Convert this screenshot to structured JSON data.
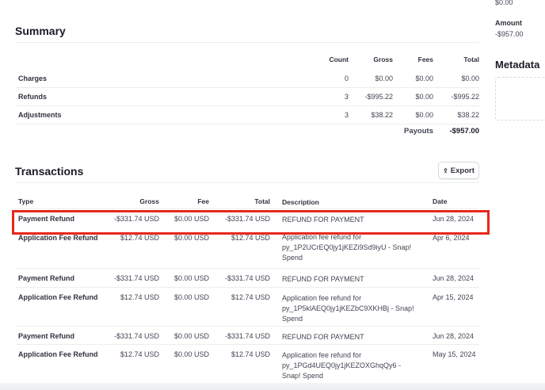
{
  "side": {
    "top_value": "$0.00",
    "amount_label": "Amount",
    "amount_value": "-$957.00",
    "metadata_title": "Metadata"
  },
  "summary": {
    "title": "Summary",
    "columns": [
      "Count",
      "Gross",
      "Fees",
      "Total"
    ],
    "rows": [
      {
        "label": "Charges",
        "count": "0",
        "gross": "$0.00",
        "fees": "$0.00",
        "total": "$0.00"
      },
      {
        "label": "Refunds",
        "count": "3",
        "gross": "-$995.22",
        "fees": "$0.00",
        "total": "-$995.22"
      },
      {
        "label": "Adjustments",
        "count": "3",
        "gross": "$38.22",
        "fees": "$0.00",
        "total": "$38.22"
      }
    ],
    "payouts_label": "Payouts",
    "payouts_value": "-$957.00"
  },
  "transactions": {
    "title": "Transactions",
    "export_label": "Export",
    "columns": [
      "Type",
      "Gross",
      "Fee",
      "Total",
      "Description",
      "Date"
    ],
    "rows": [
      {
        "type": "Payment Refund",
        "gross": "-$331.74 USD",
        "fee": "$0.00 USD",
        "total": "-$331.74 USD",
        "desc": "REFUND FOR PAYMENT",
        "date": "Jun 28, 2024"
      },
      {
        "type": "Application Fee Refund",
        "gross": "$12.74 USD",
        "fee": "$0.00 USD",
        "total": "$12.74 USD",
        "desc": "Application fee refund for py_1P2UCrEQ0jy1jKEZi9Sd9iyU - Snap! Spend",
        "date": "Apr 6, 2024"
      },
      {
        "type": "Payment Refund",
        "gross": "-$331.74 USD",
        "fee": "$0.00 USD",
        "total": "-$331.74 USD",
        "desc": "REFUND FOR PAYMENT",
        "date": "Jun 28, 2024"
      },
      {
        "type": "Application Fee Refund",
        "gross": "$12.74 USD",
        "fee": "$0.00 USD",
        "total": "$12.74 USD",
        "desc": "Application fee refund for py_1P5klAEQ0jy1jKEZbC9XKHBj - Snap! Spend",
        "date": "Apr 15, 2024"
      },
      {
        "type": "Payment Refund",
        "gross": "-$331.74 USD",
        "fee": "$0.00 USD",
        "total": "-$331.74 USD",
        "desc": "REFUND FOR PAYMENT",
        "date": "Jun 28, 2024"
      },
      {
        "type": "Application Fee Refund",
        "gross": "$12.74 USD",
        "fee": "$0.00 USD",
        "total": "$12.74 USD",
        "desc": "Application fee refund for py_1PGd4UEQ0jy1jKEZOXGhqQy6 - Snap! Spend",
        "date": "May 15, 2024"
      }
    ]
  },
  "icons": {
    "export": "export-arrow-icon"
  },
  "colors": {
    "highlight": "#e8271c"
  }
}
